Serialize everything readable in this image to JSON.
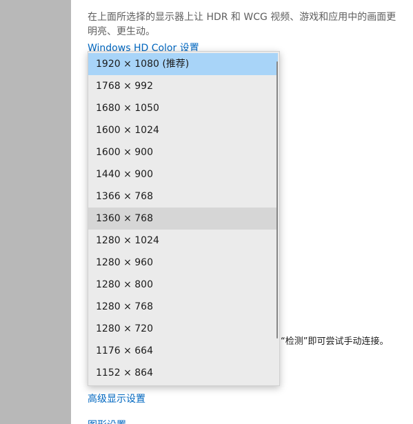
{
  "settings": {
    "description": "在上面所选择的显示器上让 HDR 和 WCG 视频、游戏和应用中的画面更明亮、更生动。",
    "hd_color_link": "Windows HD Color 设置",
    "detect_hint": "“检测”即可尝试手动连接。",
    "advanced_display_link": "高级显示设置",
    "graphics_link": "图形设置"
  },
  "resolution_dropdown": {
    "selected": "1920 × 1080 (推荐)",
    "hovered": "1360 × 768",
    "options": [
      "1920 × 1080 (推荐)",
      "1768 × 992",
      "1680 × 1050",
      "1600 × 1024",
      "1600 × 900",
      "1440 × 900",
      "1366 × 768",
      "1360 × 768",
      "1280 × 1024",
      "1280 × 960",
      "1280 × 800",
      "1280 × 768",
      "1280 × 720",
      "1176 × 664",
      "1152 × 864"
    ]
  },
  "colors": {
    "link": "#0067c0",
    "selected_option": "#a8d4f8",
    "hovered_option": "#d6d6d6",
    "dropdown_bg": "#ebebeb",
    "left_panel": "#b8b8b8"
  }
}
